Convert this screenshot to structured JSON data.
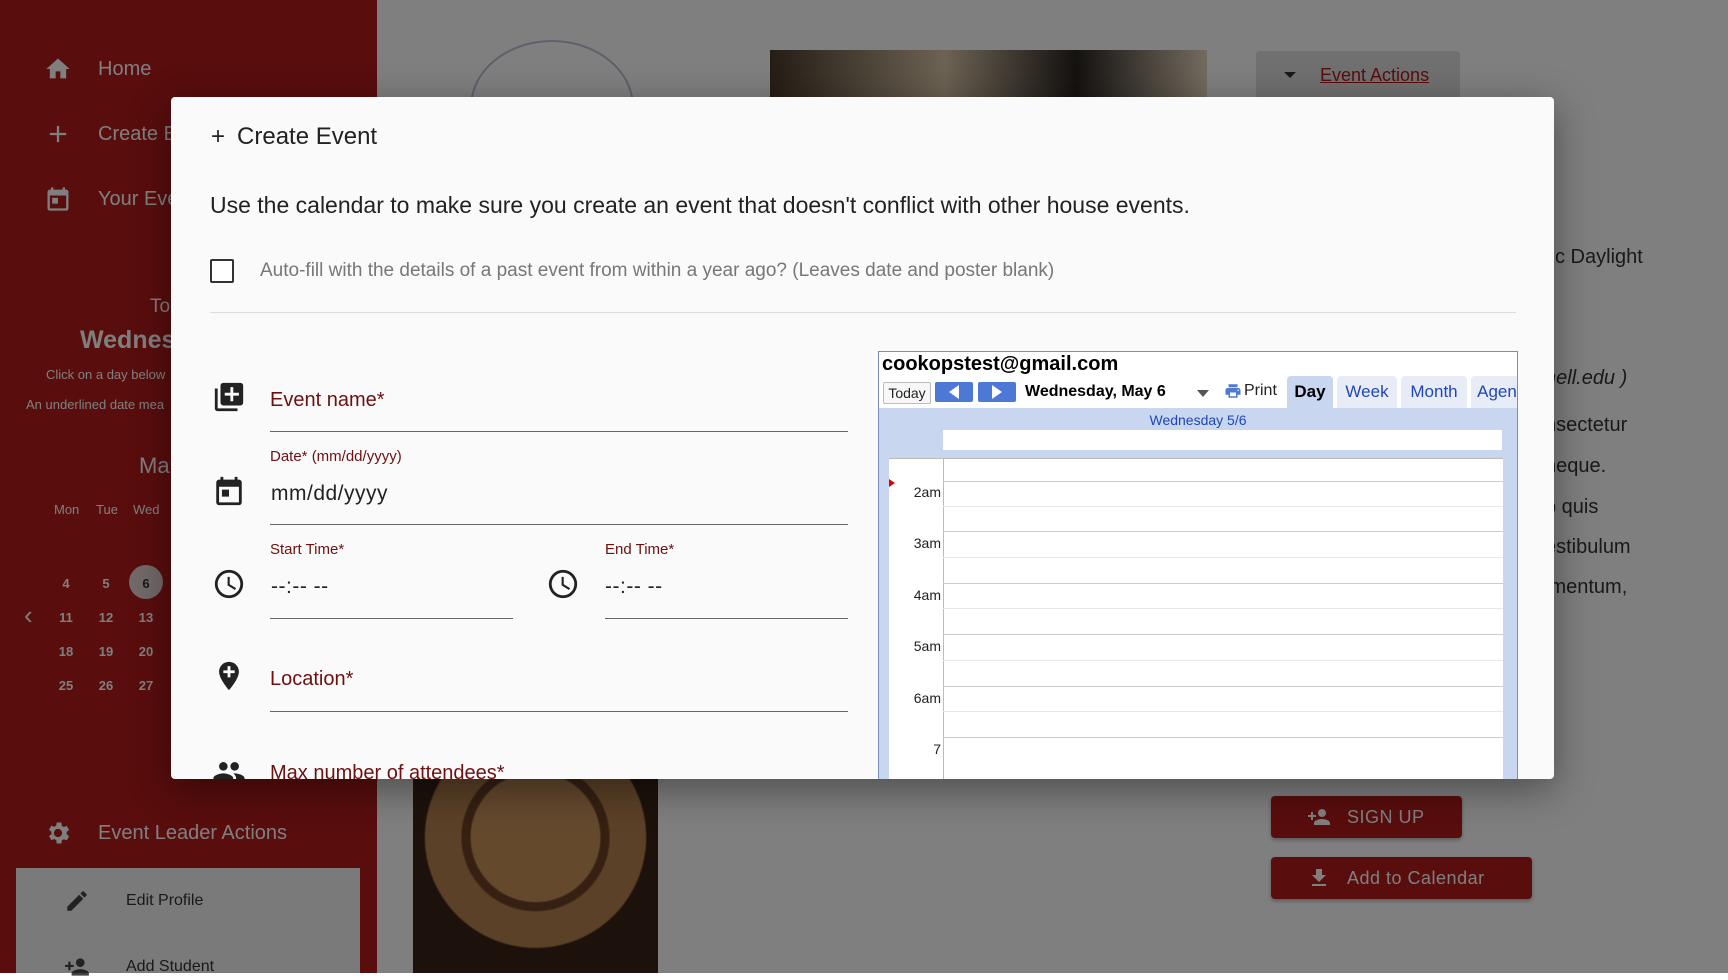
{
  "sidebar": {
    "nav": [
      {
        "label": "Home",
        "icon": "home-icon"
      },
      {
        "label": "Create E",
        "icon": "plus-icon"
      },
      {
        "label": "Your Eve",
        "icon": "calendar-icon"
      }
    ],
    "today_label": "To",
    "today_day": "Wednes",
    "hint1": "Click on a day below",
    "hint2": "An underlined date mea",
    "month": "Ma",
    "weekdays": [
      "Mon",
      "Tue",
      "Wed"
    ],
    "weeks": [
      [
        "4",
        "5",
        "6"
      ],
      [
        "11",
        "12",
        "13"
      ],
      [
        "18",
        "19",
        "20"
      ],
      [
        "25",
        "26",
        "27"
      ]
    ],
    "selected_day": "6",
    "leader_actions": "Event Leader Actions",
    "leader_items": [
      "Edit Profile",
      "Add Student"
    ]
  },
  "main": {
    "event_actions": "Event Actions",
    "bg_lines": [
      "fic Daylight",
      "nell.edu )",
      "nsectetur",
      "neque.",
      "o quis",
      "estibulum",
      "imentum,"
    ],
    "signup": "SIGN UP",
    "add_calendar": "Add to Calendar"
  },
  "dialog": {
    "title": "Create Event",
    "description": "Use the calendar to make sure you create an event that doesn't conflict with other house events.",
    "autofill_label": "Auto-fill with the details of a past event from within a year ago? (Leaves date and poster blank)",
    "event_name_label": "Event name*",
    "date_label": "Date* (mm/dd/yyyy)",
    "date_placeholder": "mm/dd/yyyy",
    "start_label": "Start Time*",
    "start_placeholder": "--:-- --",
    "end_label": "End Time*",
    "end_placeholder": "--:-- --",
    "location_label": "Location*",
    "max_attendees_label": "Max number of attendees*"
  },
  "gcal": {
    "email": "cookopstest@gmail.com",
    "today": "Today",
    "date_range": "Wednesday, May 6",
    "print": "Print",
    "tabs": [
      "Day",
      "Week",
      "Month",
      "Agen"
    ],
    "active_tab": "Day",
    "column_header": "Wednesday 5/6",
    "hours": [
      "2am",
      "3am",
      "4am",
      "5am",
      "6am",
      "7"
    ]
  },
  "colors": {
    "brand_red": "#b31b1b",
    "google_blue": "#4d78d6",
    "label_dark_red": "#6d1010"
  }
}
